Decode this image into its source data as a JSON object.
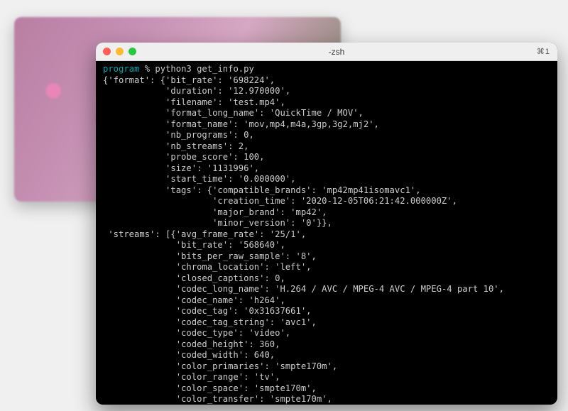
{
  "window": {
    "title": "-zsh",
    "shortcut": "⌘1"
  },
  "prompt": {
    "host": "program",
    "separator": " % ",
    "command": "python3 get_info.py"
  },
  "output_lines": [
    "{'format': {'bit_rate': '698224',",
    "            'duration': '12.970000',",
    "            'filename': 'test.mp4',",
    "            'format_long_name': 'QuickTime / MOV',",
    "            'format_name': 'mov,mp4,m4a,3gp,3g2,mj2',",
    "            'nb_programs': 0,",
    "            'nb_streams': 2,",
    "            'probe_score': 100,",
    "            'size': '1131996',",
    "            'start_time': '0.000000',",
    "            'tags': {'compatible_brands': 'mp42mp41isomavc1',",
    "                     'creation_time': '2020-12-05T06:21:42.000000Z',",
    "                     'major_brand': 'mp42',",
    "                     'minor_version': '0'}},",
    " 'streams': [{'avg_frame_rate': '25/1',",
    "              'bit_rate': '568640',",
    "              'bits_per_raw_sample': '8',",
    "              'chroma_location': 'left',",
    "              'closed_captions': 0,",
    "              'codec_long_name': 'H.264 / AVC / MPEG-4 AVC / MPEG-4 part 10',",
    "              'codec_name': 'h264',",
    "              'codec_tag': '0x31637661',",
    "              'codec_tag_string': 'avc1',",
    "              'codec_type': 'video',",
    "              'coded_height': 360,",
    "              'coded_width': 640,",
    "              'color_primaries': 'smpte170m',",
    "              'color_range': 'tv',",
    "              'color_space': 'smpte170m',",
    "              'color_transfer': 'smpte170m',"
  ]
}
